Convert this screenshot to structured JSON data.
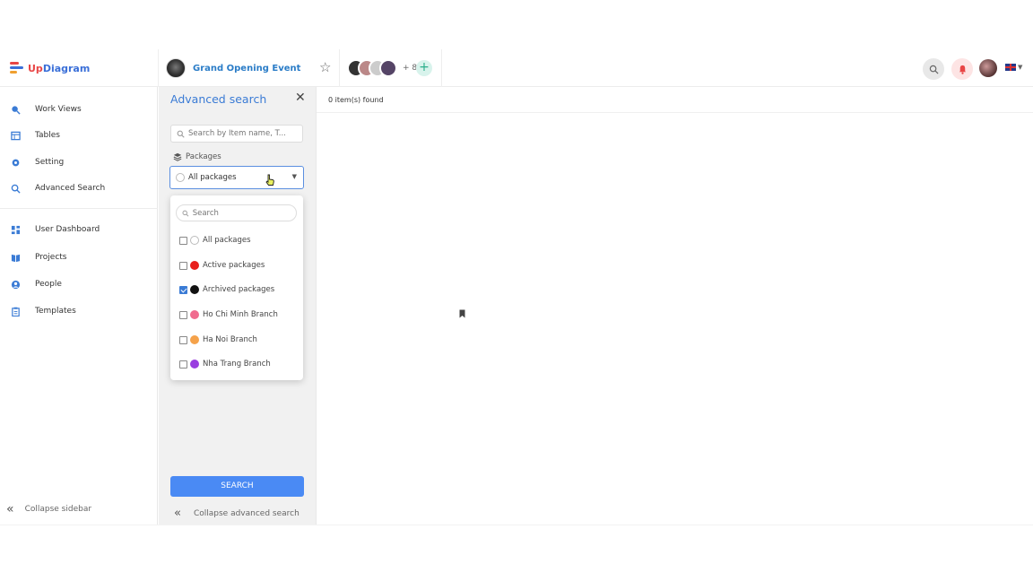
{
  "header": {
    "logo_up": "Up",
    "logo_rest": "Diagram",
    "project_title": "Grand Opening Event",
    "member_extra": "+ 8"
  },
  "sidebar": {
    "items": [
      {
        "label": "Work Views",
        "icon": "work-views-icon"
      },
      {
        "label": "Tables",
        "icon": "tables-icon"
      },
      {
        "label": "Setting",
        "icon": "gear-icon"
      },
      {
        "label": "Advanced Search",
        "icon": "search-icon"
      },
      {
        "label": "User Dashboard",
        "icon": "dashboard-icon"
      },
      {
        "label": "Projects",
        "icon": "book-icon"
      },
      {
        "label": "People",
        "icon": "person-icon"
      },
      {
        "label": "Templates",
        "icon": "clipboard-icon"
      }
    ],
    "collapse_label": "Collapse sidebar"
  },
  "advanced_search": {
    "title": "Advanced search",
    "search_placeholder": "Search by Item name, T...",
    "packages_label": "Packages",
    "selected_package": "All packages",
    "search_button": "SEARCH",
    "collapse_label": "Collapse advanced search"
  },
  "dropdown": {
    "search_placeholder": "Search",
    "options": [
      {
        "label": "All packages",
        "checked": false,
        "color": "#ffffff"
      },
      {
        "label": "Active packages",
        "checked": false,
        "color": "#e8201c"
      },
      {
        "label": "Archived packages",
        "checked": true,
        "color": "#111111"
      },
      {
        "label": "Ho Chi Minh Branch",
        "checked": false,
        "color": "#f06b8e"
      },
      {
        "label": "Ha Noi Branch",
        "checked": false,
        "color": "#f5a24a"
      },
      {
        "label": "Nha Trang Branch",
        "checked": false,
        "color": "#9a3ee0"
      }
    ]
  },
  "main": {
    "result_count": "0 item(s) found"
  },
  "colors": {
    "accent": "#3a7bd5",
    "button": "#4a8af4"
  }
}
